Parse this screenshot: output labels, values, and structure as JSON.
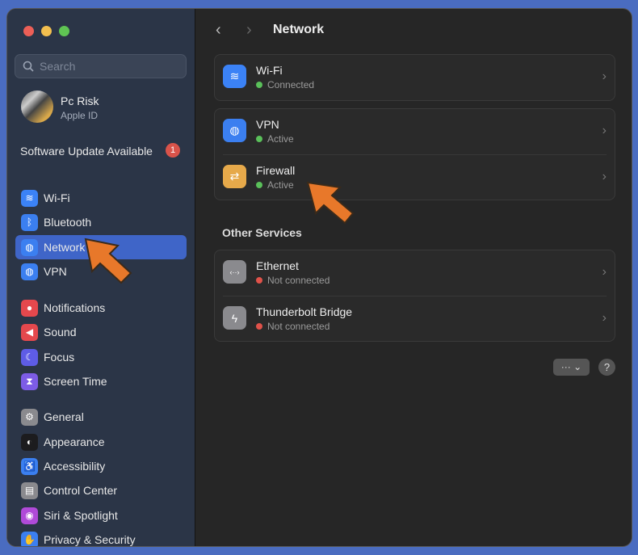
{
  "sidebar": {
    "search_placeholder": "Search",
    "user": {
      "name": "Pc Risk",
      "sub": "Apple ID"
    },
    "update": {
      "label": "Software Update Available",
      "count": "1"
    },
    "items": [
      {
        "label": "Wi-Fi",
        "color": "#3b82f6",
        "glyph": "≋"
      },
      {
        "label": "Bluetooth",
        "color": "#3b7ff0",
        "glyph": "ᛒ"
      },
      {
        "label": "Network",
        "color": "#3b7ff0",
        "glyph": "◍"
      },
      {
        "label": "VPN",
        "color": "#3b7ff0",
        "glyph": "◍"
      },
      {
        "label": "Notifications",
        "color": "#e5484d",
        "glyph": "●"
      },
      {
        "label": "Sound",
        "color": "#e5484d",
        "glyph": "◀"
      },
      {
        "label": "Focus",
        "color": "#5e5ce6",
        "glyph": "☾"
      },
      {
        "label": "Screen Time",
        "color": "#7d5ce6",
        "glyph": "⧗"
      },
      {
        "label": "General",
        "color": "#8a8a8e",
        "glyph": "⚙"
      },
      {
        "label": "Appearance",
        "color": "#1c1c1e",
        "glyph": "◐"
      },
      {
        "label": "Accessibility",
        "color": "#3b7ff0",
        "glyph": "♿"
      },
      {
        "label": "Control Center",
        "color": "#8a8a8e",
        "glyph": "▤"
      },
      {
        "label": "Siri & Spotlight",
        "color": "#b04ad8",
        "glyph": "◉"
      },
      {
        "label": "Privacy & Security",
        "color": "#3b7ff0",
        "glyph": "✋"
      }
    ],
    "selected": "Network"
  },
  "main": {
    "title": "Network",
    "back": "‹",
    "forward": "›",
    "services": [
      {
        "name": "Wi-Fi",
        "status": "Connected",
        "status_color": "#5ac05a",
        "icon_color": "#3b82f6",
        "glyph": "≋"
      },
      {
        "name": "VPN",
        "status": "Active",
        "status_color": "#5ac05a",
        "icon_color": "#3b7ff0",
        "glyph": "◍"
      },
      {
        "name": "Firewall",
        "status": "Active",
        "status_color": "#5ac05a",
        "icon_color": "#e6a94a",
        "glyph": "⇄"
      }
    ],
    "other_title": "Other Services",
    "other": [
      {
        "name": "Ethernet",
        "status": "Not connected",
        "status_color": "#e0524a",
        "icon_color": "#8a8a8e",
        "glyph": "‹··›"
      },
      {
        "name": "Thunderbolt Bridge",
        "status": "Not connected",
        "status_color": "#e0524a",
        "icon_color": "#8a8a8e",
        "glyph": "ϟ"
      }
    ],
    "more_label": "··· ⌄",
    "help_label": "?"
  }
}
